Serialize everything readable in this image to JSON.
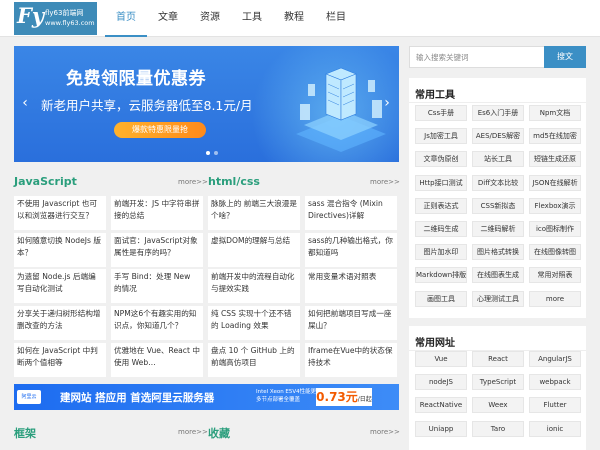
{
  "logo": {
    "mark": "Fy",
    "line1": "fly63前端网",
    "line2": "www.fly63.com"
  },
  "nav": [
    "首页",
    "文章",
    "资源",
    "工具",
    "教程",
    "栏目"
  ],
  "banner": {
    "title": "免费领限量优惠券",
    "subtitle": "新老用户共享，云服务器低至8.1元/月",
    "cta": "爆款特惠限量抢",
    "prev": "‹",
    "next": "›"
  },
  "sections": {
    "javascript": {
      "title": "JavaScript",
      "more": "more>>"
    },
    "htmlcss": {
      "title": "html/css",
      "more": "more>>"
    },
    "framework": {
      "title": "框架",
      "more": "more>>"
    },
    "favorites": {
      "title": "收藏",
      "more": "more>>"
    }
  },
  "articles": [
    [
      "不使用 Javascript 也可以和浏览器进行交互？",
      "前端开发：JS 中字符串拼接的总结",
      "脉脉上的 前端三大浪漫是个啥？",
      "sass 混合指令 (Mixin Directives)详解"
    ],
    [
      "如何随意切换 NodeJs 版本？",
      "面试官：JavaScript对象属性是有序的吗？",
      "虚拟DOM的理解与总结",
      "sass的几种输出格式，你都知道吗"
    ],
    [
      "为遗留 Node.js 后端编写自动化测试",
      "手写 Bind：处理 New 的情况",
      "前端开发中的流程自动化与提效实践",
      "常用变量术语对照表"
    ],
    [
      "分享关于递归树形结构增删改查的方法",
      "NPM这6个有趣实用的知识点，你知道几个？",
      "纯 CSS 实现十个还不错的 Loading 效果",
      "如何把前端项目写成一座屎山？"
    ],
    [
      "如何在 JavaScript 中判断两个值相等",
      "优雅地在 Vue、React 中使用 Web…",
      "盘点 10 个 GitHub 上的前端高仿项目",
      "Iframe在Vue中的状态保持技术"
    ]
  ],
  "ad": {
    "logo": "阿里云",
    "text": "建网站 搭应用 首选阿里云服务器",
    "detail_1": "Intel Xeon E5V4性能更优",
    "detail_2": "多节点部署全覆盖",
    "price": "0.73元",
    "unit": "/日起"
  },
  "search": {
    "placeholder": "输入搜索关键词",
    "button": "搜文"
  },
  "tools": {
    "title": "常用工具",
    "items": [
      "Css手册",
      "Es6入门手册",
      "Npm文档",
      "Js加密工具",
      "AES/DES解密",
      "md5在线加密",
      "文章伪原创",
      "站长工具",
      "短链生成还原",
      "Http接口测试",
      "Diff文本比较",
      "JSON在线解析",
      "正则表达式",
      "CSS新拟态",
      "Flexbox演示",
      "二维码生成",
      "二维码解析",
      "ico图标制作",
      "图片加水印",
      "图片格式转换",
      "在线图像转图",
      "Markdown排版",
      "在线图表生成",
      "常用对照表",
      "画图工具",
      "心理测试工具",
      "more"
    ]
  },
  "sites": {
    "title": "常用网址",
    "items": [
      "Vue",
      "React",
      "AngularJS",
      "nodeJS",
      "TypeScript",
      "webpack",
      "ReactNative",
      "Weex",
      "Flutter",
      "Uniapp",
      "Taro",
      "ionic"
    ]
  },
  "colors": {
    "accent": "#3b8fc5",
    "section": "#2a9e7c",
    "page_bg": "#f0f0f0"
  }
}
